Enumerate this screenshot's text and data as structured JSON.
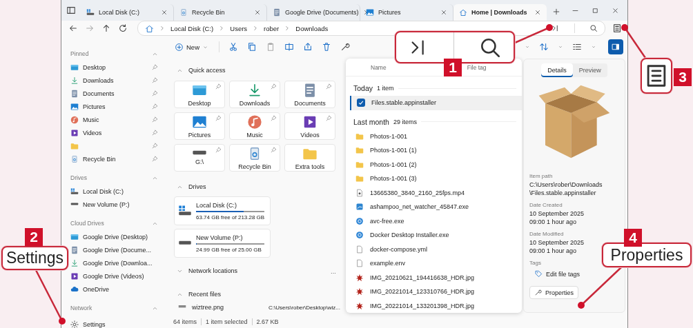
{
  "tabs": [
    {
      "label": "Local Disk (C:)",
      "kind": "windows-drive",
      "selected": false
    },
    {
      "label": "Recycle Bin",
      "kind": "recycle-bin",
      "selected": false
    },
    {
      "label": "Google Drive (Documents)",
      "kind": "document",
      "selected": false
    },
    {
      "label": "Pictures",
      "kind": "picture",
      "selected": false
    },
    {
      "label": "Home | Downloads",
      "kind": "home",
      "selected": true
    }
  ],
  "address": {
    "crumbs": [
      "Local Disk (C:)",
      "Users",
      "rober",
      "Downloads"
    ]
  },
  "toolbar": {
    "new": "New"
  },
  "sidebar": {
    "sections": [
      {
        "title": "Pinned",
        "expanded": true,
        "items": [
          {
            "label": "Desktop",
            "kind": "desktop",
            "pinned": true
          },
          {
            "label": "Downloads",
            "kind": "download",
            "pinned": true
          },
          {
            "label": "Documents",
            "kind": "document",
            "pinned": true
          },
          {
            "label": "Pictures",
            "kind": "picture",
            "pinned": true
          },
          {
            "label": "Music",
            "kind": "music",
            "pinned": true
          },
          {
            "label": "Videos",
            "kind": "video",
            "pinned": true
          },
          {
            "kind": "folder",
            "pinned": true
          },
          {
            "label": "Recycle Bin",
            "kind": "recycle-bin",
            "pinned": true
          }
        ]
      },
      {
        "title": "Drives",
        "expanded": true,
        "items": [
          {
            "label": "Local Disk (C:)",
            "kind": "windows-drive"
          },
          {
            "label": "New Volume (P:)",
            "kind": "drive"
          }
        ]
      },
      {
        "title": "Cloud Drives",
        "expanded": true,
        "items": [
          {
            "label": "Google Drive (Desktop)",
            "kind": "desktop"
          },
          {
            "label": "Google Drive (Docume...",
            "kind": "document"
          },
          {
            "label": "Google Drive (Downloa...",
            "kind": "download"
          },
          {
            "label": "Google Drive (Videos)",
            "kind": "video"
          },
          {
            "label": "OneDrive",
            "kind": "cloud"
          }
        ]
      },
      {
        "title": "Network",
        "expanded": true
      }
    ],
    "footer": "Settings"
  },
  "home": {
    "sections": [
      {
        "kind": "tiles",
        "title": "Quick access",
        "expanded": true,
        "items": [
          {
            "label": "Desktop",
            "kind": "desktop",
            "pinned": true
          },
          {
            "label": "Downloads",
            "kind": "download",
            "pinned": true
          },
          {
            "label": "Documents",
            "kind": "document",
            "pinned": true
          },
          {
            "label": "Pictures",
            "kind": "picture",
            "pinned": true
          },
          {
            "label": "Music",
            "kind": "music",
            "pinned": true
          },
          {
            "label": "Videos",
            "kind": "video",
            "pinned": true
          },
          {
            "label": "G:\\",
            "kind": "drive",
            "pinned": true
          },
          {
            "label": "Recycle Bin",
            "kind": "recycle-bin",
            "pinned": true
          },
          {
            "label": "Extra tools",
            "kind": "folder",
            "pinned": false
          }
        ]
      },
      {
        "kind": "drives",
        "title": "Drives",
        "expanded": true,
        "items": [
          {
            "label": "Local Disk (C:)",
            "kind": "windows-drive",
            "free": "63.74 GB free of 213.28 GB",
            "level": 0.7
          },
          {
            "label": "New Volume (P:)",
            "kind": "drive",
            "free": "24.99 GB free of 25.00 GB",
            "level": 0.004
          }
        ]
      },
      {
        "kind": "empty",
        "title": "Network locations",
        "expanded": false,
        "more": "..."
      },
      {
        "kind": "recent",
        "title": "Recent files",
        "expanded": true,
        "items": [
          {
            "label": "wiztree.png",
            "kind": "image-file",
            "path": "C:\\Users\\rober\\Desktop\\wiz..."
          }
        ]
      }
    ]
  },
  "files": {
    "columns": [
      "Name",
      "File tag"
    ],
    "groups": [
      {
        "title": "Today",
        "count": "1 item",
        "rows": [
          {
            "name": "Files.stable.appinstaller",
            "selected": true
          }
        ]
      },
      {
        "title": "Last month",
        "count": "29 items",
        "rows": [
          {
            "name": "Photos-1-001",
            "kind": "folder",
            "selected": false
          },
          {
            "name": "Photos-1-001 (1)",
            "kind": "folder",
            "selected": false
          },
          {
            "name": "Photos-1-001 (2)",
            "kind": "folder",
            "selected": false
          },
          {
            "name": "Photos-1-001 (3)",
            "kind": "folder",
            "selected": false
          },
          {
            "name": "13665380_3840_2160_25fps.mp4",
            "kind": "video-file",
            "selected": false
          },
          {
            "name": "ashampoo_net_watcher_45847.exe",
            "kind": "app",
            "selected": false
          },
          {
            "name": "avc-free.exe",
            "kind": "round-app",
            "selected": false
          },
          {
            "name": "Docker Desktop Installer.exe",
            "kind": "round-app",
            "selected": false
          },
          {
            "name": "docker-compose.yml",
            "kind": "file",
            "selected": false
          },
          {
            "name": "example.env",
            "kind": "file",
            "selected": false
          },
          {
            "name": "IMG_20210621_194416638_HDR.jpg",
            "kind": "starburst",
            "selected": false
          },
          {
            "name": "IMG_20221014_123310766_HDR.jpg",
            "kind": "starburst",
            "selected": false
          },
          {
            "name": "IMG_20221014_133201398_HDR.jpg",
            "kind": "starburst",
            "selected": false
          }
        ]
      }
    ]
  },
  "details": {
    "tabs": [
      {
        "label": "Details",
        "selected": true
      },
      {
        "label": "Preview",
        "selected": false
      }
    ],
    "fields": [
      {
        "label": "Item path",
        "lines": [
          "C:\\Users\\rober\\Downloads",
          "\\Files.stable.appinstaller"
        ]
      },
      {
        "label": "Date Created",
        "value": "10 September 2025 09:00 1 hour ago"
      },
      {
        "label": "Date Modified",
        "value": "10 September 2025 09:00 1 hour ago"
      }
    ],
    "tags_label": "Tags",
    "edit_tags": "Edit file tags",
    "properties": "Properties"
  },
  "status": [
    "64 items",
    "1 item selected",
    "2.67 KB"
  ],
  "callouts": [
    {
      "number": "1",
      "kind": "icons"
    },
    {
      "number": "2",
      "kind": "label",
      "label": "Settings"
    },
    {
      "number": "3",
      "kind": "icon"
    },
    {
      "number": "4",
      "kind": "label",
      "label": "Properties"
    }
  ]
}
